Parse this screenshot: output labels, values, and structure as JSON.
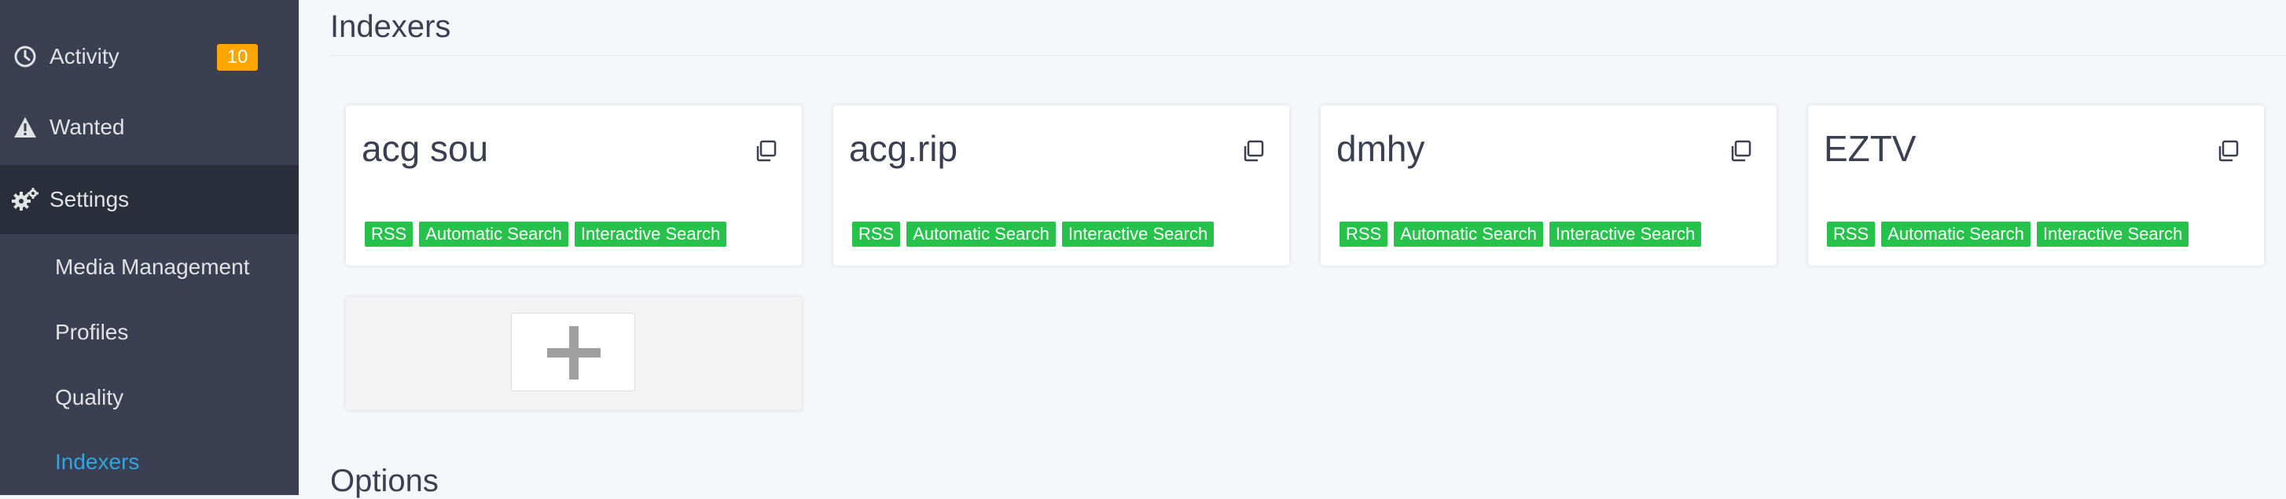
{
  "sidebar": {
    "items": [
      {
        "label": "Activity",
        "icon": "clock-icon",
        "badge": "10"
      },
      {
        "label": "Wanted",
        "icon": "warning-icon"
      },
      {
        "label": "Settings",
        "icon": "gears-icon"
      }
    ],
    "subitems": [
      {
        "label": "Media Management"
      },
      {
        "label": "Profiles"
      },
      {
        "label": "Quality"
      },
      {
        "label": "Indexers"
      }
    ],
    "active_subitem": "Indexers"
  },
  "main": {
    "title": "Indexers",
    "indexers": [
      {
        "name": "acg sou",
        "tags": [
          "RSS",
          "Automatic Search",
          "Interactive Search"
        ]
      },
      {
        "name": "acg.rip",
        "tags": [
          "RSS",
          "Automatic Search",
          "Interactive Search"
        ]
      },
      {
        "name": "dmhy",
        "tags": [
          "RSS",
          "Automatic Search",
          "Interactive Search"
        ]
      },
      {
        "name": "EZTV",
        "tags": [
          "RSS",
          "Automatic Search",
          "Interactive Search"
        ]
      }
    ],
    "add_icon": "plus-icon",
    "options_title": "Options"
  },
  "colors": {
    "sidebar_bg": "#3a3f51",
    "sidebar_active_bg": "#2a2e3a",
    "badge": "#ffa500",
    "tag": "#27c24c",
    "active_link": "#30a6e0"
  }
}
